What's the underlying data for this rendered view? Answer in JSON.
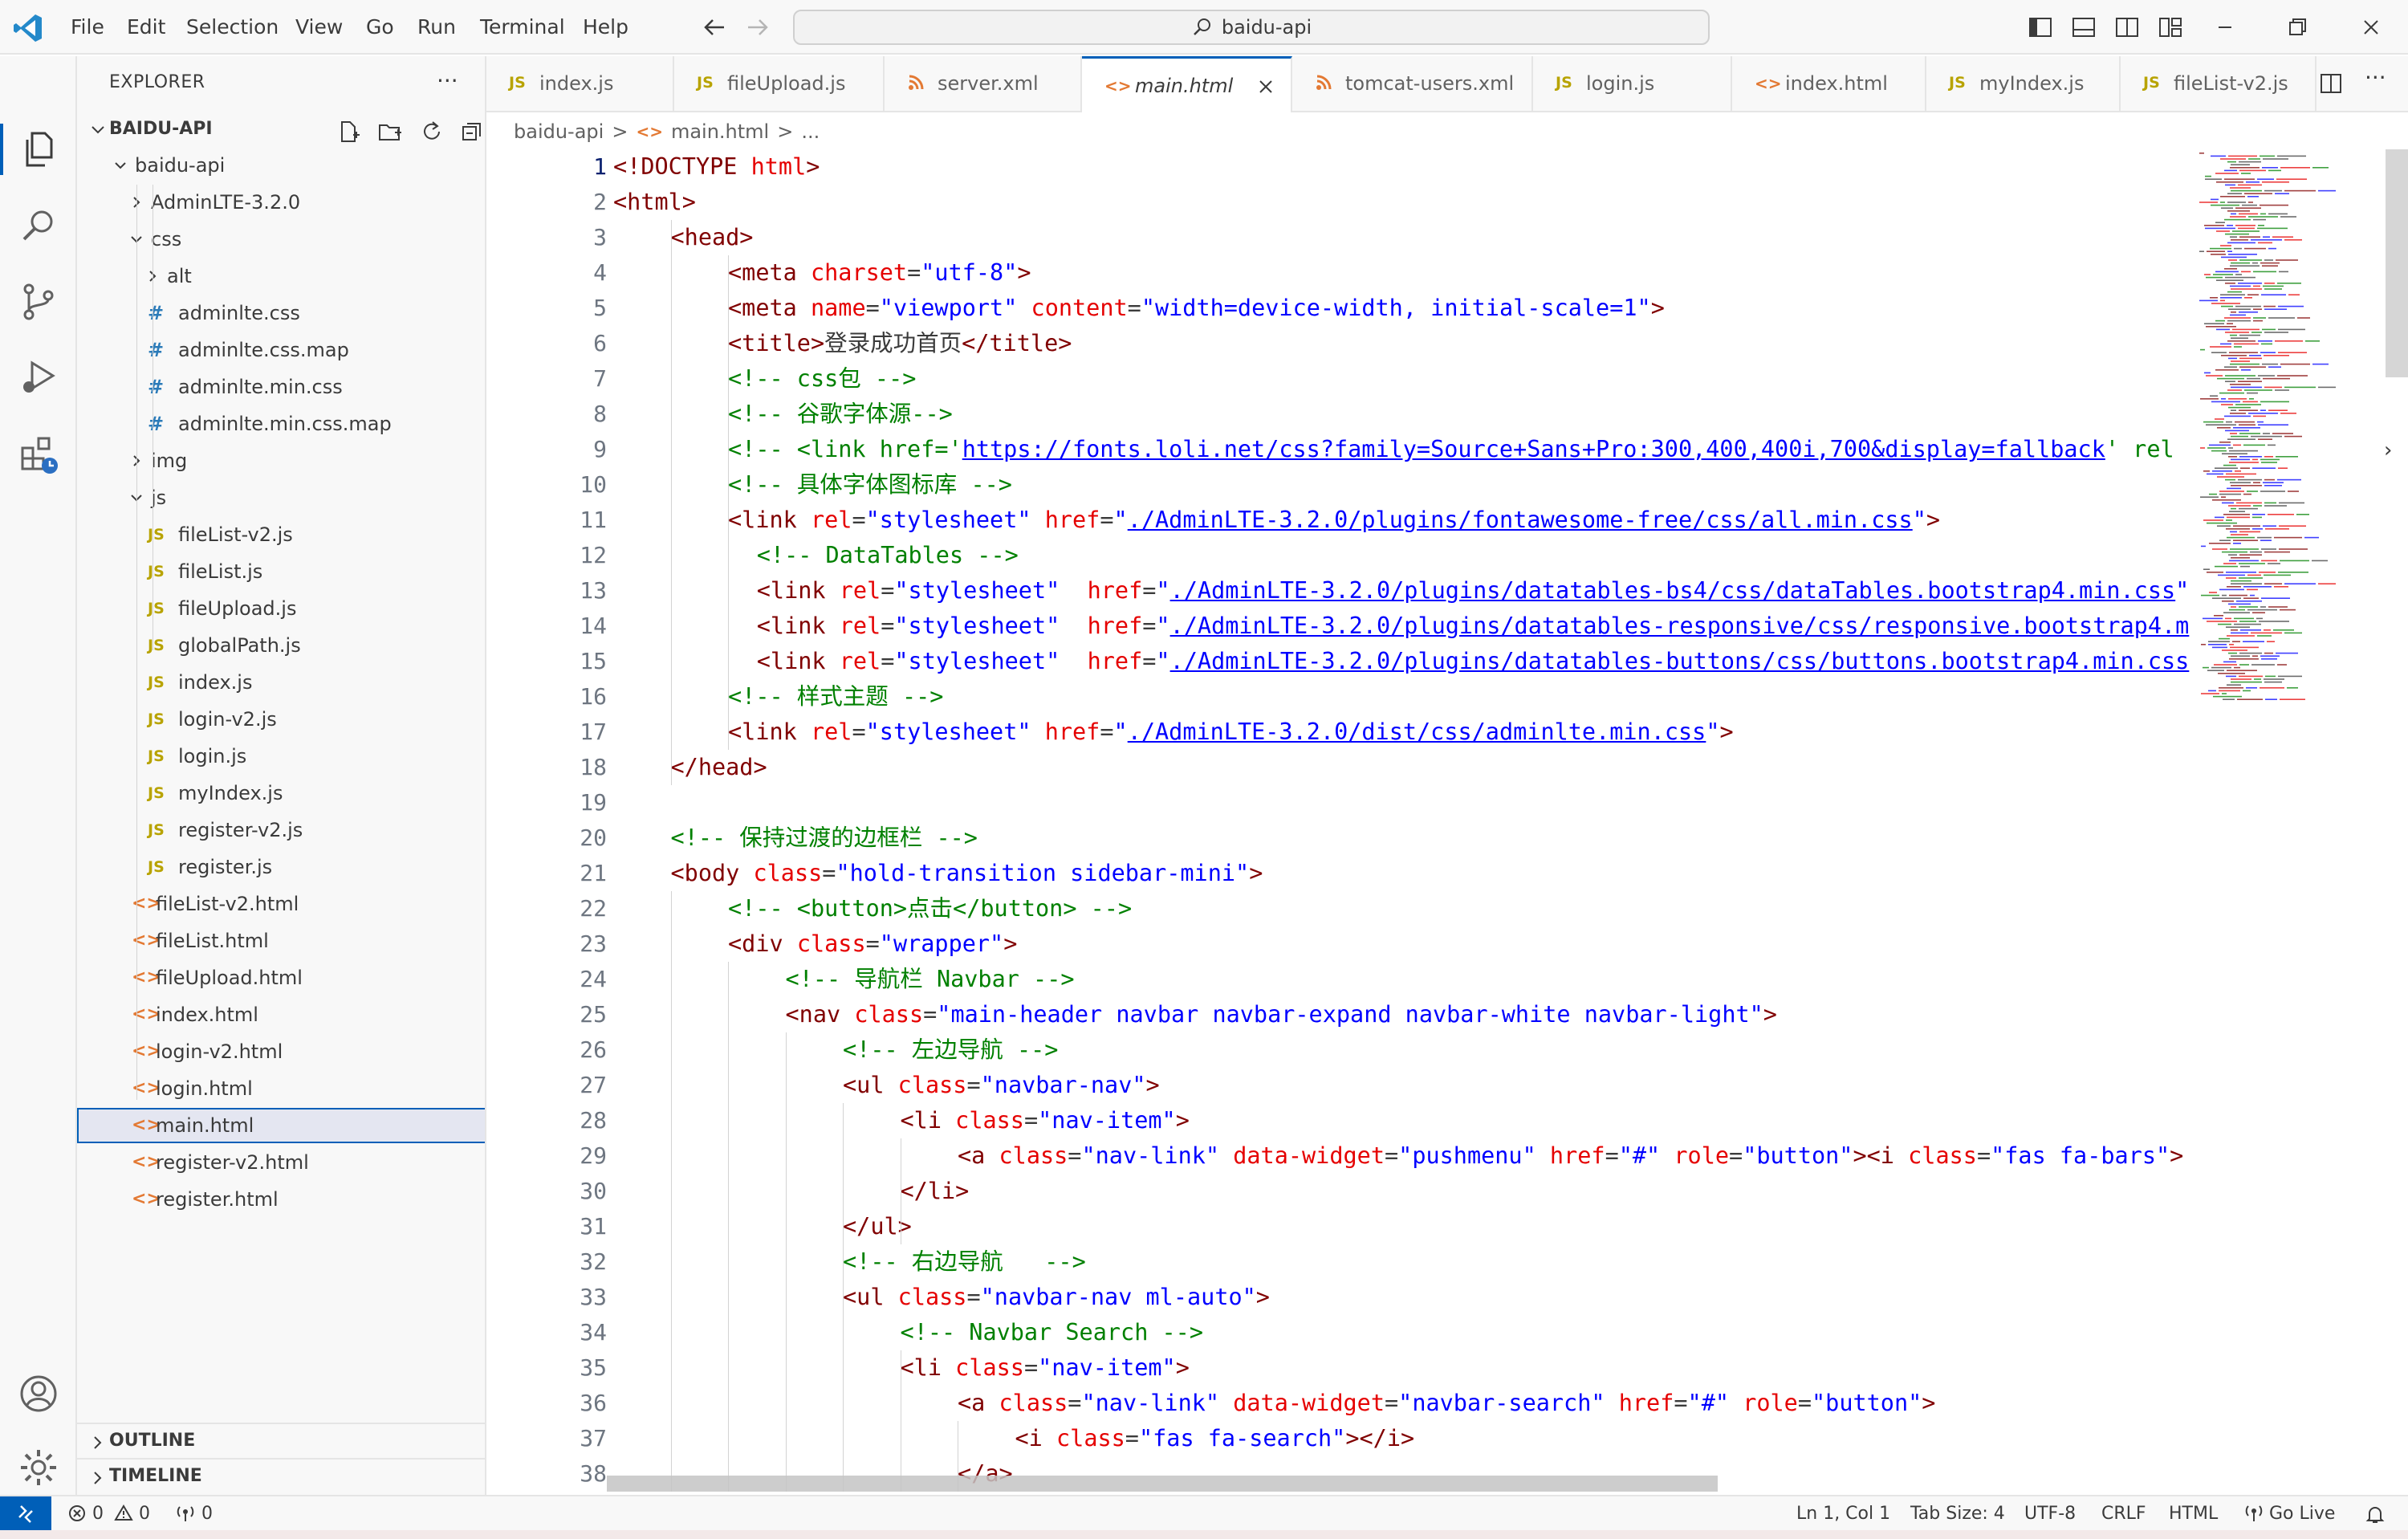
{
  "menu": [
    "File",
    "Edit",
    "Selection",
    "View",
    "Go",
    "Run",
    "Terminal",
    "Help"
  ],
  "search": {
    "text": "baidu-api"
  },
  "explorer": {
    "title": "EXPLORER",
    "more": "···",
    "root": "BAIDU-API",
    "tree": [
      {
        "label": "baidu-api",
        "kind": "folder-open"
      },
      {
        "label": "AdminLTE-3.2.0",
        "kind": "folder"
      },
      {
        "label": "css",
        "kind": "folder-open"
      },
      {
        "label": "alt",
        "kind": "folder"
      },
      {
        "label": "adminlte.css",
        "kind": "css",
        "icon": "#"
      },
      {
        "label": "adminlte.css.map",
        "kind": "css",
        "icon": "#"
      },
      {
        "label": "adminlte.min.css",
        "kind": "css",
        "icon": "#"
      },
      {
        "label": "adminlte.min.css.map",
        "kind": "css",
        "icon": "#"
      },
      {
        "label": "img",
        "kind": "folder"
      },
      {
        "label": "js",
        "kind": "folder-open"
      },
      {
        "label": "fileList-v2.js",
        "kind": "js",
        "icon": "JS"
      },
      {
        "label": "fileList.js",
        "kind": "js",
        "icon": "JS"
      },
      {
        "label": "fileUpload.js",
        "kind": "js",
        "icon": "JS"
      },
      {
        "label": "globalPath.js",
        "kind": "js",
        "icon": "JS"
      },
      {
        "label": "index.js",
        "kind": "js",
        "icon": "JS"
      },
      {
        "label": "login-v2.js",
        "kind": "js",
        "icon": "JS"
      },
      {
        "label": "login.js",
        "kind": "js",
        "icon": "JS"
      },
      {
        "label": "myIndex.js",
        "kind": "js",
        "icon": "JS"
      },
      {
        "label": "register-v2.js",
        "kind": "js",
        "icon": "JS"
      },
      {
        "label": "register.js",
        "kind": "js",
        "icon": "JS"
      },
      {
        "label": "fileList-v2.html",
        "kind": "html",
        "icon": "<>"
      },
      {
        "label": "fileList.html",
        "kind": "html",
        "icon": "<>"
      },
      {
        "label": "fileUpload.html",
        "kind": "html",
        "icon": "<>"
      },
      {
        "label": "index.html",
        "kind": "html",
        "icon": "<>"
      },
      {
        "label": "login-v2.html",
        "kind": "html",
        "icon": "<>"
      },
      {
        "label": "login.html",
        "kind": "html",
        "icon": "<>"
      },
      {
        "label": "main.html",
        "kind": "html",
        "icon": "<>",
        "selected": true
      },
      {
        "label": "register-v2.html",
        "kind": "html",
        "icon": "<>"
      },
      {
        "label": "register.html",
        "kind": "html",
        "icon": "<>"
      }
    ],
    "outline": "OUTLINE",
    "timeline": "TIMELINE"
  },
  "tabs": [
    {
      "label": "index.js",
      "icon": "JS"
    },
    {
      "label": "fileUpload.js",
      "icon": "JS"
    },
    {
      "label": "server.xml",
      "icon": "rss"
    },
    {
      "label": "main.html",
      "icon": "<>",
      "active": true
    },
    {
      "label": "tomcat-users.xml",
      "icon": "rss"
    },
    {
      "label": "login.js",
      "icon": "JS"
    },
    {
      "label": "index.html",
      "icon": "<>"
    },
    {
      "label": "myIndex.js",
      "icon": "JS"
    },
    {
      "label": "fileList-v2.js",
      "icon": "JS"
    }
  ],
  "breadcrumb": {
    "folder": "baidu-api",
    "sep": ">",
    "file": "main.html",
    "sep2": ">",
    "tail": "..."
  },
  "editor": {
    "first_line": 1,
    "current_line": 1,
    "lines": [
      {
        "i": 0,
        "t": [
          [
            "tk-tag",
            "<!DOCTYPE"
          ],
          [
            "tk-txt",
            " "
          ],
          [
            "tk-attr",
            "html"
          ],
          [
            "tk-tag",
            ">"
          ]
        ]
      },
      {
        "i": 0,
        "t": [
          [
            "tk-tag",
            "<html>"
          ]
        ]
      },
      {
        "i": 1,
        "t": [
          [
            "tk-tag",
            "<head>"
          ]
        ]
      },
      {
        "i": 2,
        "t": [
          [
            "tk-tag",
            "<meta"
          ],
          [
            "tk-txt",
            " "
          ],
          [
            "tk-attr",
            "charset"
          ],
          [
            "tk-txt",
            "="
          ],
          [
            "tk-val",
            "\"utf-8\""
          ],
          [
            "tk-tag",
            ">"
          ]
        ]
      },
      {
        "i": 2,
        "t": [
          [
            "tk-tag",
            "<meta"
          ],
          [
            "tk-txt",
            " "
          ],
          [
            "tk-attr",
            "name"
          ],
          [
            "tk-txt",
            "="
          ],
          [
            "tk-val",
            "\"viewport\""
          ],
          [
            "tk-txt",
            " "
          ],
          [
            "tk-attr",
            "content"
          ],
          [
            "tk-txt",
            "="
          ],
          [
            "tk-val",
            "\"width=device-width, initial-scale=1\""
          ],
          [
            "tk-tag",
            ">"
          ]
        ]
      },
      {
        "i": 2,
        "t": [
          [
            "tk-tag",
            "<title>"
          ],
          [
            "tk-txt",
            "登录成功首页"
          ],
          [
            "tk-tag",
            "</title>"
          ]
        ]
      },
      {
        "i": 2,
        "t": [
          [
            "tk-com",
            "<!-- css包 -->"
          ]
        ]
      },
      {
        "i": 2,
        "t": [
          [
            "tk-com",
            "<!-- 谷歌字体源-->"
          ]
        ]
      },
      {
        "i": 2,
        "t": [
          [
            "tk-com",
            "<!-- <link href='"
          ],
          [
            "tk-link",
            "https://fonts.loli.net/css?family=Source+Sans+Pro:300,400,400i,700&display=fallback"
          ],
          [
            "tk-com",
            "' rel"
          ]
        ]
      },
      {
        "i": 2,
        "t": [
          [
            "tk-com",
            "<!-- 具体字体图标库 -->"
          ]
        ]
      },
      {
        "i": 2,
        "t": [
          [
            "tk-tag",
            "<link"
          ],
          [
            "tk-txt",
            " "
          ],
          [
            "tk-attr",
            "rel"
          ],
          [
            "tk-txt",
            "="
          ],
          [
            "tk-val",
            "\"stylesheet\""
          ],
          [
            "tk-txt",
            " "
          ],
          [
            "tk-attr",
            "href"
          ],
          [
            "tk-txt",
            "="
          ],
          [
            "tk-val",
            "\""
          ],
          [
            "tk-link",
            "./AdminLTE-3.2.0/plugins/fontawesome-free/css/all.min.css"
          ],
          [
            "tk-val",
            "\""
          ],
          [
            "tk-tag",
            ">"
          ]
        ]
      },
      {
        "i": 2.5,
        "t": [
          [
            "tk-com",
            "<!-- DataTables -->"
          ]
        ]
      },
      {
        "i": 2.5,
        "t": [
          [
            "tk-tag",
            "<link"
          ],
          [
            "tk-txt",
            " "
          ],
          [
            "tk-attr",
            "rel"
          ],
          [
            "tk-txt",
            "="
          ],
          [
            "tk-val",
            "\"stylesheet\""
          ],
          [
            "tk-txt",
            "  "
          ],
          [
            "tk-attr",
            "href"
          ],
          [
            "tk-txt",
            "="
          ],
          [
            "tk-val",
            "\""
          ],
          [
            "tk-link",
            "./AdminLTE-3.2.0/plugins/datatables-bs4/css/dataTables.bootstrap4.min.css"
          ],
          [
            "tk-val",
            "\""
          ]
        ]
      },
      {
        "i": 2.5,
        "t": [
          [
            "tk-tag",
            "<link"
          ],
          [
            "tk-txt",
            " "
          ],
          [
            "tk-attr",
            "rel"
          ],
          [
            "tk-txt",
            "="
          ],
          [
            "tk-val",
            "\"stylesheet\""
          ],
          [
            "tk-txt",
            "  "
          ],
          [
            "tk-attr",
            "href"
          ],
          [
            "tk-txt",
            "="
          ],
          [
            "tk-val",
            "\""
          ],
          [
            "tk-link",
            "./AdminLTE-3.2.0/plugins/datatables-responsive/css/responsive.bootstrap4.m"
          ]
        ]
      },
      {
        "i": 2.5,
        "t": [
          [
            "tk-tag",
            "<link"
          ],
          [
            "tk-txt",
            " "
          ],
          [
            "tk-attr",
            "rel"
          ],
          [
            "tk-txt",
            "="
          ],
          [
            "tk-val",
            "\"stylesheet\""
          ],
          [
            "tk-txt",
            "  "
          ],
          [
            "tk-attr",
            "href"
          ],
          [
            "tk-txt",
            "="
          ],
          [
            "tk-val",
            "\""
          ],
          [
            "tk-link",
            "./AdminLTE-3.2.0/plugins/datatables-buttons/css/buttons.bootstrap4.min.css"
          ]
        ]
      },
      {
        "i": 2,
        "t": [
          [
            "tk-com",
            "<!-- 样式主题 -->"
          ]
        ]
      },
      {
        "i": 2,
        "t": [
          [
            "tk-tag",
            "<link"
          ],
          [
            "tk-txt",
            " "
          ],
          [
            "tk-attr",
            "rel"
          ],
          [
            "tk-txt",
            "="
          ],
          [
            "tk-val",
            "\"stylesheet\""
          ],
          [
            "tk-txt",
            " "
          ],
          [
            "tk-attr",
            "href"
          ],
          [
            "tk-txt",
            "="
          ],
          [
            "tk-val",
            "\""
          ],
          [
            "tk-link",
            "./AdminLTE-3.2.0/dist/css/adminlte.min.css"
          ],
          [
            "tk-val",
            "\""
          ],
          [
            "tk-tag",
            ">"
          ]
        ]
      },
      {
        "i": 1,
        "t": [
          [
            "tk-tag",
            "</head>"
          ]
        ]
      },
      {
        "i": 0,
        "t": []
      },
      {
        "i": 1,
        "t": [
          [
            "tk-com",
            "<!-- 保持过渡的边框栏 -->"
          ]
        ]
      },
      {
        "i": 1,
        "t": [
          [
            "tk-tag",
            "<body"
          ],
          [
            "tk-txt",
            " "
          ],
          [
            "tk-attr",
            "class"
          ],
          [
            "tk-txt",
            "="
          ],
          [
            "tk-val",
            "\"hold-transition sidebar-mini\""
          ],
          [
            "tk-tag",
            ">"
          ]
        ]
      },
      {
        "i": 2,
        "t": [
          [
            "tk-com",
            "<!-- <button>点击</button> -->"
          ]
        ]
      },
      {
        "i": 2,
        "t": [
          [
            "tk-tag",
            "<div"
          ],
          [
            "tk-txt",
            " "
          ],
          [
            "tk-attr",
            "class"
          ],
          [
            "tk-txt",
            "="
          ],
          [
            "tk-val",
            "\"wrapper\""
          ],
          [
            "tk-tag",
            ">"
          ]
        ]
      },
      {
        "i": 3,
        "t": [
          [
            "tk-com",
            "<!-- 导航栏 Navbar -->"
          ]
        ]
      },
      {
        "i": 3,
        "t": [
          [
            "tk-tag",
            "<nav"
          ],
          [
            "tk-txt",
            " "
          ],
          [
            "tk-attr",
            "class"
          ],
          [
            "tk-txt",
            "="
          ],
          [
            "tk-val",
            "\"main-header navbar navbar-expand navbar-white navbar-light\""
          ],
          [
            "tk-tag",
            ">"
          ]
        ]
      },
      {
        "i": 4,
        "t": [
          [
            "tk-com",
            "<!-- 左边导航 -->"
          ]
        ]
      },
      {
        "i": 4,
        "t": [
          [
            "tk-tag",
            "<ul"
          ],
          [
            "tk-txt",
            " "
          ],
          [
            "tk-attr",
            "class"
          ],
          [
            "tk-txt",
            "="
          ],
          [
            "tk-val",
            "\"navbar-nav\""
          ],
          [
            "tk-tag",
            ">"
          ]
        ]
      },
      {
        "i": 5,
        "t": [
          [
            "tk-tag",
            "<li"
          ],
          [
            "tk-txt",
            " "
          ],
          [
            "tk-attr",
            "class"
          ],
          [
            "tk-txt",
            "="
          ],
          [
            "tk-val",
            "\"nav-item\""
          ],
          [
            "tk-tag",
            ">"
          ]
        ]
      },
      {
        "i": 6,
        "t": [
          [
            "tk-tag",
            "<a"
          ],
          [
            "tk-txt",
            " "
          ],
          [
            "tk-attr",
            "class"
          ],
          [
            "tk-txt",
            "="
          ],
          [
            "tk-val",
            "\"nav-link\""
          ],
          [
            "tk-txt",
            " "
          ],
          [
            "tk-attr",
            "data-widget"
          ],
          [
            "tk-txt",
            "="
          ],
          [
            "tk-val",
            "\"pushmenu\""
          ],
          [
            "tk-txt",
            " "
          ],
          [
            "tk-attr",
            "href"
          ],
          [
            "tk-txt",
            "="
          ],
          [
            "tk-val",
            "\"#\""
          ],
          [
            "tk-txt",
            " "
          ],
          [
            "tk-attr",
            "role"
          ],
          [
            "tk-txt",
            "="
          ],
          [
            "tk-val",
            "\"button\""
          ],
          [
            "tk-tag",
            "><i"
          ],
          [
            "tk-txt",
            " "
          ],
          [
            "tk-attr",
            "class"
          ],
          [
            "tk-txt",
            "="
          ],
          [
            "tk-val",
            "\"fas fa-bars\""
          ],
          [
            "tk-tag",
            ">"
          ]
        ]
      },
      {
        "i": 5,
        "t": [
          [
            "tk-tag",
            "</li>"
          ]
        ]
      },
      {
        "i": 4,
        "t": [
          [
            "tk-tag",
            "</ul>"
          ]
        ]
      },
      {
        "i": 4,
        "t": [
          [
            "tk-com",
            "<!-- 右边导航   -->"
          ]
        ]
      },
      {
        "i": 4,
        "t": [
          [
            "tk-tag",
            "<ul"
          ],
          [
            "tk-txt",
            " "
          ],
          [
            "tk-attr",
            "class"
          ],
          [
            "tk-txt",
            "="
          ],
          [
            "tk-val",
            "\"navbar-nav ml-auto\""
          ],
          [
            "tk-tag",
            ">"
          ]
        ]
      },
      {
        "i": 5,
        "t": [
          [
            "tk-com",
            "<!-- Navbar Search -->"
          ]
        ]
      },
      {
        "i": 5,
        "t": [
          [
            "tk-tag",
            "<li"
          ],
          [
            "tk-txt",
            " "
          ],
          [
            "tk-attr",
            "class"
          ],
          [
            "tk-txt",
            "="
          ],
          [
            "tk-val",
            "\"nav-item\""
          ],
          [
            "tk-tag",
            ">"
          ]
        ]
      },
      {
        "i": 6,
        "t": [
          [
            "tk-tag",
            "<a"
          ],
          [
            "tk-txt",
            " "
          ],
          [
            "tk-attr",
            "class"
          ],
          [
            "tk-txt",
            "="
          ],
          [
            "tk-val",
            "\"nav-link\""
          ],
          [
            "tk-txt",
            " "
          ],
          [
            "tk-attr",
            "data-widget"
          ],
          [
            "tk-txt",
            "="
          ],
          [
            "tk-val",
            "\"navbar-search\""
          ],
          [
            "tk-txt",
            " "
          ],
          [
            "tk-attr",
            "href"
          ],
          [
            "tk-txt",
            "="
          ],
          [
            "tk-val",
            "\"#\""
          ],
          [
            "tk-txt",
            " "
          ],
          [
            "tk-attr",
            "role"
          ],
          [
            "tk-txt",
            "="
          ],
          [
            "tk-val",
            "\"button\""
          ],
          [
            "tk-tag",
            ">"
          ]
        ]
      },
      {
        "i": 7,
        "t": [
          [
            "tk-tag",
            "<i"
          ],
          [
            "tk-txt",
            " "
          ],
          [
            "tk-attr",
            "class"
          ],
          [
            "tk-txt",
            "="
          ],
          [
            "tk-val",
            "\"fas fa-search\""
          ],
          [
            "tk-tag",
            "></i>"
          ]
        ]
      },
      {
        "i": 6,
        "t": [
          [
            "tk-tag",
            "</a>"
          ]
        ]
      }
    ]
  },
  "status": {
    "errors": "0",
    "warnings": "0",
    "ports": "0",
    "position": "Ln 1, Col 1",
    "tab_size": "Tab Size: 4",
    "encoding": "UTF-8",
    "eol": "CRLF",
    "language": "HTML",
    "go_live": "Go Live"
  },
  "colors": {
    "accent": "#005fb8",
    "tag": "#800000",
    "attr": "#e50000",
    "value": "#0000ff",
    "comment": "#008000"
  }
}
